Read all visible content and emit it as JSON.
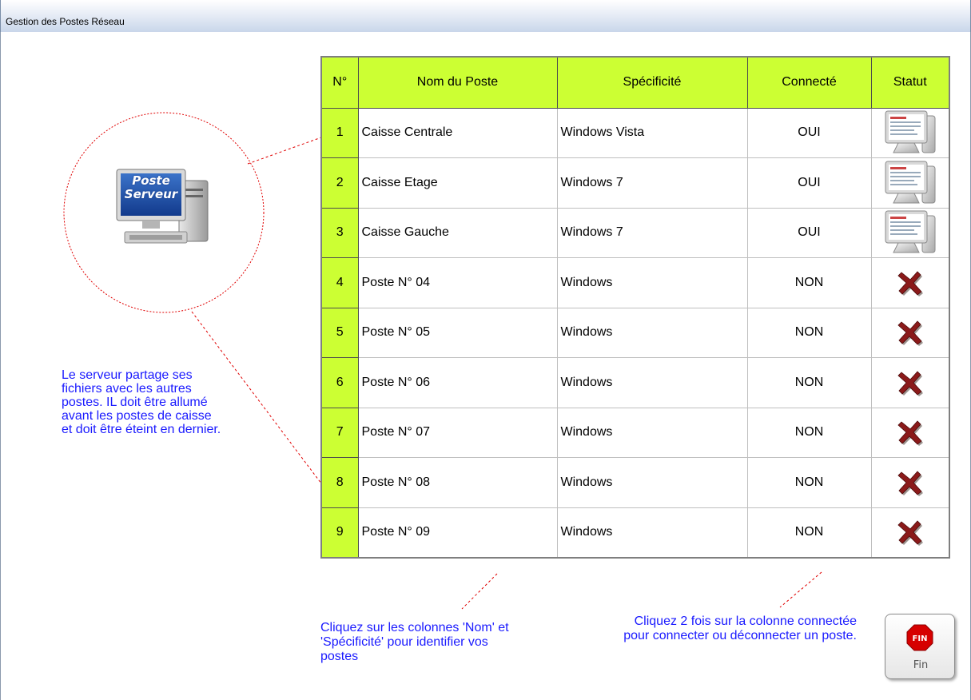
{
  "window": {
    "title": "Gestion des Postes Réseau"
  },
  "server": {
    "label_line1": "Poste",
    "label_line2": "Serveur"
  },
  "info_text": "Le serveur partage ses fichiers avec les autres postes. IL doit être allumé avant les postes de caisse et doit être éteint en dernier.",
  "table": {
    "headers": [
      "N°",
      "Nom du Poste",
      "Spécificité",
      "Connecté",
      "Statut"
    ],
    "rows": [
      {
        "num": "1",
        "name": "Caisse Centrale",
        "spec": "Windows Vista",
        "connected": "OUI",
        "status_icon": "computer-icon"
      },
      {
        "num": "2",
        "name": "Caisse Etage",
        "spec": "Windows 7",
        "connected": "OUI",
        "status_icon": "computer-icon"
      },
      {
        "num": "3",
        "name": "Caisse Gauche",
        "spec": "Windows 7",
        "connected": "OUI",
        "status_icon": "computer-icon"
      },
      {
        "num": "4",
        "name": "Poste N° 04",
        "spec": "Windows",
        "connected": "NON",
        "status_icon": "red-x-icon"
      },
      {
        "num": "5",
        "name": "Poste N° 05",
        "spec": "Windows",
        "connected": "NON",
        "status_icon": "red-x-icon"
      },
      {
        "num": "6",
        "name": "Poste N° 06",
        "spec": "Windows",
        "connected": "NON",
        "status_icon": "red-x-icon"
      },
      {
        "num": "7",
        "name": "Poste N° 07",
        "spec": "Windows",
        "connected": "NON",
        "status_icon": "red-x-icon"
      },
      {
        "num": "8",
        "name": "Poste N° 08",
        "spec": "Windows",
        "connected": "NON",
        "status_icon": "red-x-icon"
      },
      {
        "num": "9",
        "name": "Poste N° 09",
        "spec": "Windows",
        "connected": "NON",
        "status_icon": "red-x-icon"
      }
    ]
  },
  "hints": {
    "left": "Cliquez sur les colonnes 'Nom' et 'Spécificité' pour identifier vos postes",
    "right": "Cliquez 2 fois sur la colonne connectée pour connecter ou déconnecter un poste."
  },
  "fin_button": {
    "icon_text": "FIN",
    "label": "Fin"
  },
  "colors": {
    "header_green": "#ccff33",
    "hint_blue": "#1a1aff",
    "dashed_red": "#e00000"
  }
}
